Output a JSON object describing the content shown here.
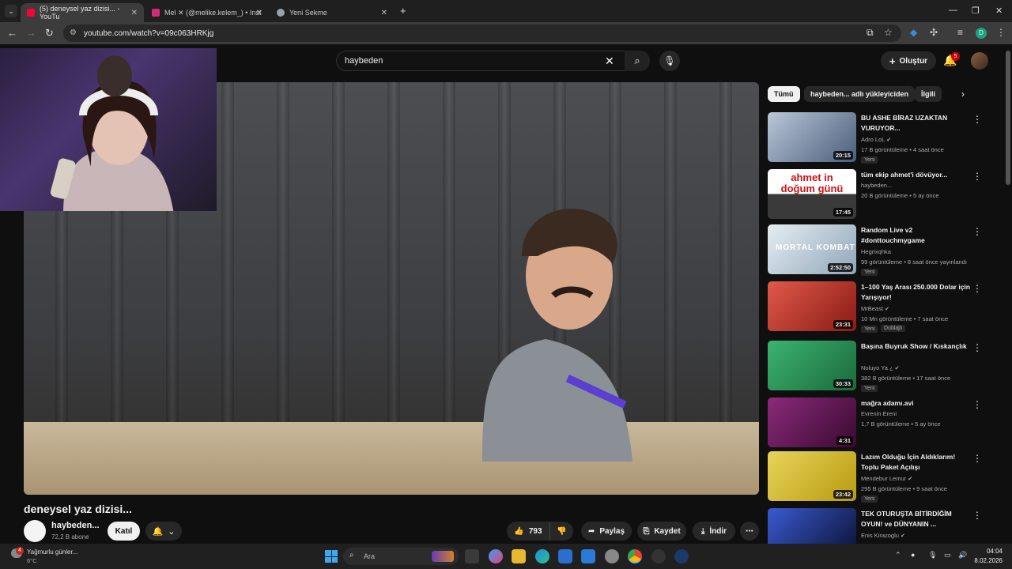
{
  "browser": {
    "tabs": [
      {
        "label": "(5) deneysel yaz dizisi... - YouTu",
        "active": true,
        "color": "#ff0033"
      },
      {
        "label": "Mel ✕ (@melike.kelem_) • Inst",
        "active": false,
        "color": "#d62976"
      },
      {
        "label": "Yeni Sekme",
        "active": false,
        "color": "#9aa0a6"
      }
    ],
    "new_tab": "+",
    "url": "youtube.com/watch?v=09c063HRKjg"
  },
  "youtube": {
    "search_value": "haybeden",
    "create_label": "Oluştur",
    "notification_count": "5",
    "video_title": "deneysel yaz dizisi...",
    "channel": {
      "name": "haybeden...",
      "subs": "72,2 B abone",
      "join": "Katıl"
    },
    "actions": {
      "likes": "793",
      "share": "Paylaş",
      "save": "Kaydet",
      "download": "İndir"
    },
    "chips": [
      "Tümü",
      "haybeden... adlı yükleyiciden",
      "İlgili"
    ],
    "recommendations": [
      {
        "title": "BU ASHE BİRAZ UZAKTAN VURUYOR...",
        "channel": "Adro LoL",
        "meta": "17 B görüntüleme • 4 saat önce",
        "badge": "Yeni",
        "badge2": "",
        "duration": "20:15",
        "thumb_color": "#6a7f9a"
      },
      {
        "title": "tüm ekip ahmet'i dövüyor...",
        "channel": "haybeden...",
        "meta": "20 B görüntüleme • 5 ay önce",
        "badge": "",
        "badge2": "",
        "duration": "17:45",
        "thumb_color": "#3a3a3a"
      },
      {
        "title": "Random Live v2 #donttouchmygame",
        "channel": "Hegrixqhka",
        "meta": "99 görüntüleme • 8 saat önce yayınlandı",
        "badge": "Yeni",
        "badge2": "",
        "duration": "2:52:50",
        "thumb_color": "#8fa6b8"
      },
      {
        "title": "1–100 Yaş Arası 250.000 Dolar için Yarışıyor!",
        "channel": "MrBeast",
        "meta": "10 Mn görüntüleme • 7 saat önce",
        "badge": "Yeni",
        "badge2": "Dublajlı",
        "duration": "23:31",
        "thumb_color": "#c0392b"
      },
      {
        "title": "Başına Buyruk Show / Kıskançlık",
        "channel": "Noluyo Ya ¿",
        "meta": "382 B görüntüleme • 17 saat önce",
        "badge": "Yeni",
        "badge2": "",
        "duration": "30:33",
        "thumb_color": "#2d8f5a"
      },
      {
        "title": "mağra adamı.avi",
        "channel": "Evrenin Ereni",
        "meta": "1,7 B görüntüleme • 5 ay önce",
        "badge": "",
        "badge2": "",
        "duration": "4:31",
        "thumb_color": "#6b2060"
      },
      {
        "title": "Lazım Olduğu İçin Aldıklarım! Toplu Paket Açılışı",
        "channel": "Mendebur Lemur",
        "meta": "295 B görüntüleme • 9 saat önce",
        "badge": "Yeni",
        "badge2": "",
        "duration": "23:42",
        "thumb_color": "#b8a020"
      },
      {
        "title": "TEK OTURUŞTA BİTİRDİĞİM OYUN! ve DÜNYANIN ...",
        "channel": "Enis Kirazoglu",
        "meta": "",
        "badge": "",
        "badge2": "",
        "duration": "",
        "thumb_color": "#1a2a6a"
      }
    ]
  },
  "taskbar": {
    "weather_text": "Yağmurlu günler...",
    "weather_temp": "6°C",
    "weather_badge": "4",
    "search_placeholder": "Ara",
    "time": "04:04",
    "date": "8.02.2026"
  },
  "colors": {
    "accent": "#ff0033",
    "bg": "#0f0f0f",
    "chip": "#272727"
  }
}
